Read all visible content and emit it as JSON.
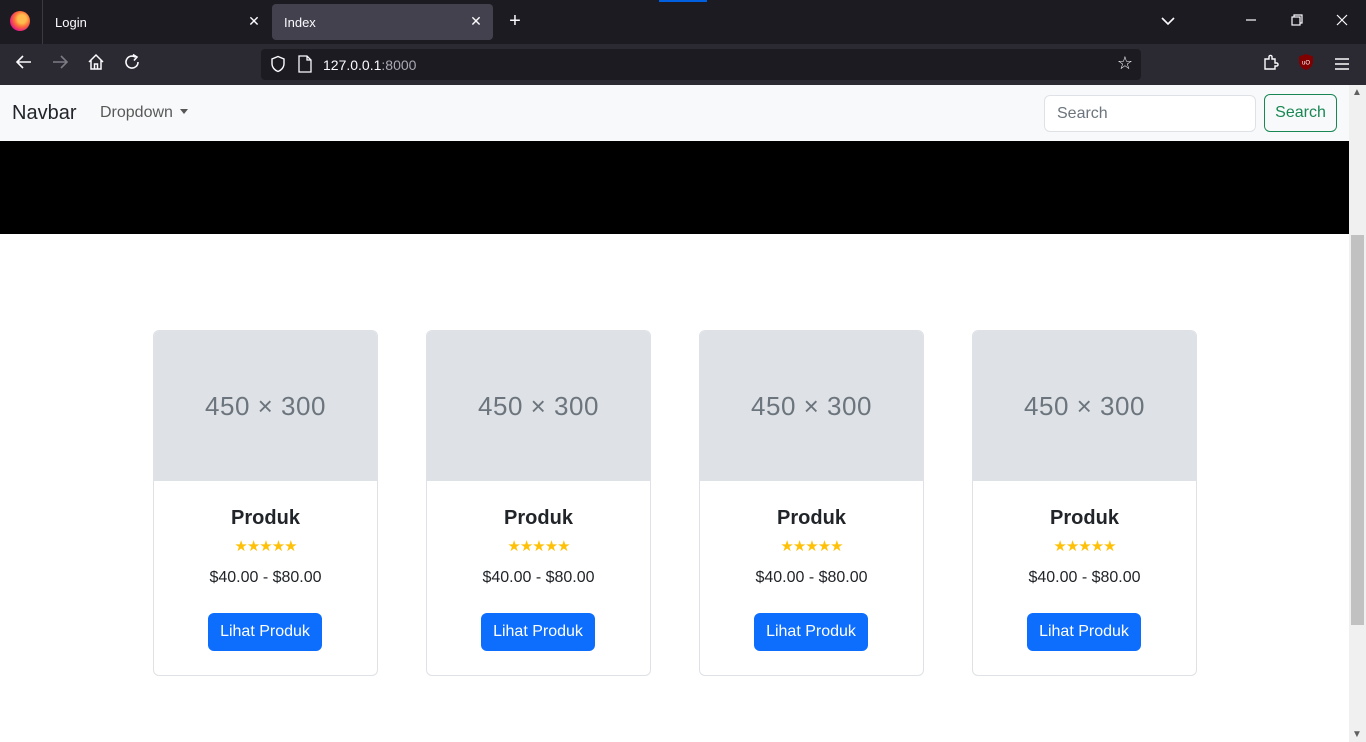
{
  "browser": {
    "tabs": [
      {
        "label": "Login",
        "close": "✕"
      },
      {
        "label": "Index",
        "close": "✕"
      }
    ],
    "new_tab": "+",
    "url_host": "127.0.0.1",
    "url_port": ":8000"
  },
  "navbar": {
    "brand": "Navbar",
    "dropdown": "Dropdown",
    "search_placeholder": "Search",
    "search_button": "Search"
  },
  "cards": [
    {
      "image_label": "450 × 300",
      "title": "Produk",
      "rating": "★★★★★",
      "price": "$40.00 - $80.00",
      "button": "Lihat Produk"
    },
    {
      "image_label": "450 × 300",
      "title": "Produk",
      "rating": "★★★★★",
      "price": "$40.00 - $80.00",
      "button": "Lihat Produk"
    },
    {
      "image_label": "450 × 300",
      "title": "Produk",
      "rating": "★★★★★",
      "price": "$40.00 - $80.00",
      "button": "Lihat Produk"
    },
    {
      "image_label": "450 × 300",
      "title": "Produk",
      "rating": "★★★★★",
      "price": "$40.00 - $80.00",
      "button": "Lihat Produk"
    }
  ],
  "colors": {
    "primary": "#0d6efd",
    "success": "#198754",
    "star": "#ffc107"
  }
}
